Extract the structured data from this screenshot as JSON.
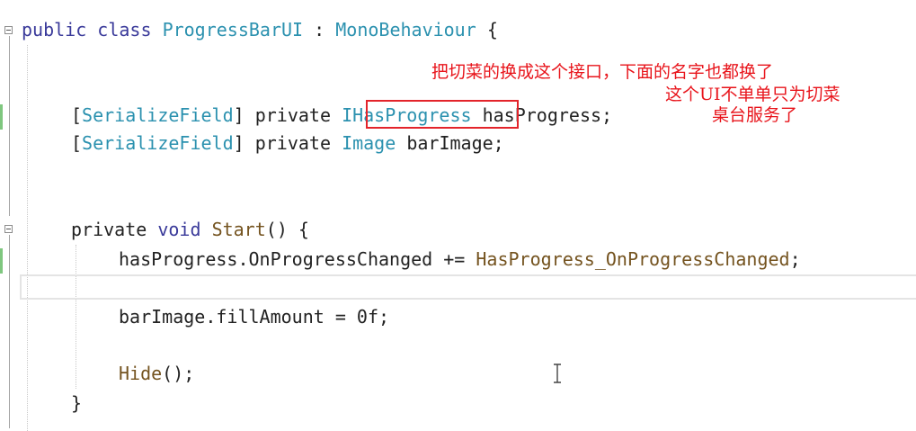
{
  "code": {
    "line1": {
      "kw1": "public",
      "kw2": "class",
      "name": "ProgressBarUI",
      "sep": " : ",
      "base": "MonoBehaviour",
      "brace": " {"
    },
    "line2": {
      "attr_open": "[",
      "attr": "SerializeField",
      "attr_close": "] ",
      "kw": "private",
      "type": "IHasProgress",
      "rest": " hasProgress;"
    },
    "line3": {
      "attr_open": "[",
      "attr": "SerializeField",
      "attr_close": "] ",
      "kw": "private",
      "type": "Image",
      "rest": " barImage;"
    },
    "line4": {
      "kw1": "private",
      "kw2": "void",
      "fn": "Start",
      "rest": "() {"
    },
    "line5": {
      "obj": "hasProgress.",
      "event": "OnProgressChanged",
      "op": " += ",
      "handler": "HasProgress_OnProgressChanged",
      "end": ";"
    },
    "line6": {
      "text": "barImage.fillAmount = 0f;"
    },
    "line7": {
      "fn": "Hide",
      "rest": "();"
    },
    "line8": {
      "text": "}"
    }
  },
  "annotation": {
    "line1": "把切菜的换成这个接口，下面的名字也都换了",
    "line2": "这个UI不单单只为切菜",
    "line3": "桌台服务了"
  },
  "colors": {
    "annotation": "#e8141b",
    "highlight_box": "#e3242b",
    "type": "#2b91af",
    "keyword": "#3a3a9a"
  }
}
